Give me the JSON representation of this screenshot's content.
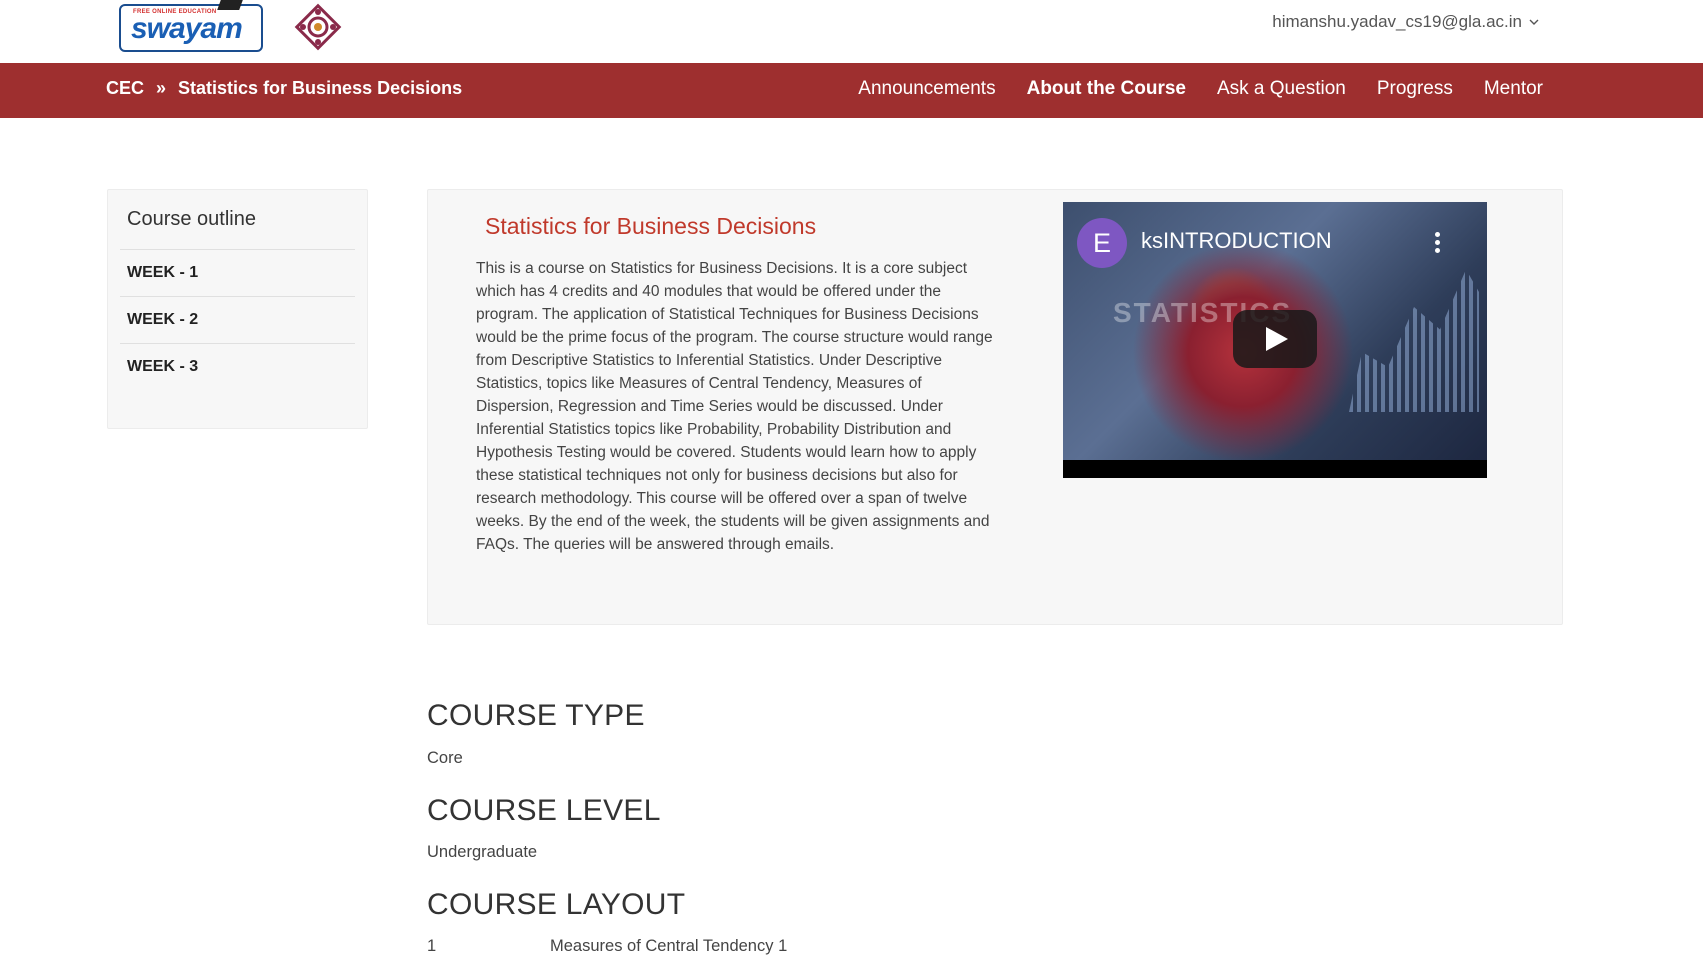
{
  "header": {
    "logo_text": "swayam",
    "logo_tagline": "FREE ONLINE EDUCATION",
    "user_email": "himanshu.yadav_cs19@gla.ac.in"
  },
  "nav": {
    "breadcrumb": [
      "CEC",
      "»",
      "Statistics for Business Decisions"
    ],
    "links": [
      "Announcements",
      "About the Course",
      "Ask a Question",
      "Progress",
      "Mentor"
    ],
    "active": "About the Course",
    "color": "#9e2f2f"
  },
  "sidebar": {
    "title": "Course outline",
    "items": [
      {
        "label": "WEEK - 1"
      },
      {
        "label": "WEEK - 2"
      },
      {
        "label": "WEEK - 3"
      }
    ]
  },
  "course": {
    "title": "Statistics for Business Decisions",
    "description": "This is a course on Statistics for Business Decisions. It is a core subject which has 4 credits and 40 modules that would be offered under the program. The application of Statistical Techniques for Business Decisions would be the prime focus of the program. The course structure would range from Descriptive Statistics to Inferential Statistics. Under Descriptive Statistics, topics like Measures of Central Tendency, Measures of Dispersion, Regression and Time Series would be discussed. Under Inferential Statistics topics like Probability, Probability Distribution and Hypothesis Testing would be covered. Students would learn how to apply these statistical techniques not only for business decisions but also for research methodology. This course will be offered over a span of twelve weeks. By the end of the week, the students will be given assignments and FAQs. The queries will be answered through emails."
  },
  "video": {
    "channel_initial": "E",
    "title": "ksINTRODUCTION",
    "overlay_text": "STATISTICS"
  },
  "sections": {
    "type_heading": "COURSE TYPE",
    "type_value": "Core",
    "level_heading": "COURSE LEVEL",
    "level_value": "Undergraduate",
    "layout_heading": "COURSE LAYOUT",
    "layout_rows": [
      {
        "week": "1",
        "topic": "Measures of Central Tendency 1"
      }
    ]
  }
}
